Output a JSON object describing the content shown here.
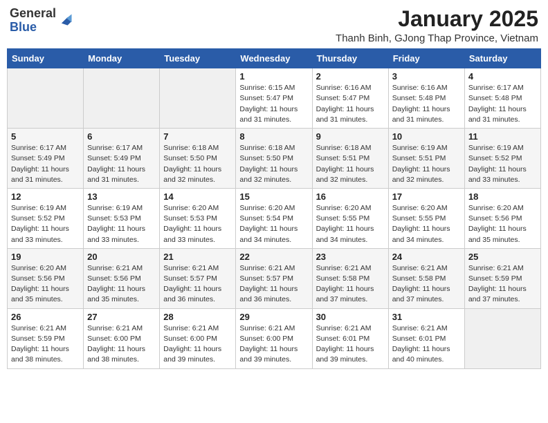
{
  "header": {
    "logo_general": "General",
    "logo_blue": "Blue",
    "month_year": "January 2025",
    "location": "Thanh Binh, GJong Thap Province, Vietnam"
  },
  "days_of_week": [
    "Sunday",
    "Monday",
    "Tuesday",
    "Wednesday",
    "Thursday",
    "Friday",
    "Saturday"
  ],
  "weeks": [
    {
      "days": [
        {
          "num": "",
          "info": ""
        },
        {
          "num": "",
          "info": ""
        },
        {
          "num": "",
          "info": ""
        },
        {
          "num": "1",
          "info": "Sunrise: 6:15 AM\nSunset: 5:47 PM\nDaylight: 11 hours\nand 31 minutes."
        },
        {
          "num": "2",
          "info": "Sunrise: 6:16 AM\nSunset: 5:47 PM\nDaylight: 11 hours\nand 31 minutes."
        },
        {
          "num": "3",
          "info": "Sunrise: 6:16 AM\nSunset: 5:48 PM\nDaylight: 11 hours\nand 31 minutes."
        },
        {
          "num": "4",
          "info": "Sunrise: 6:17 AM\nSunset: 5:48 PM\nDaylight: 11 hours\nand 31 minutes."
        }
      ]
    },
    {
      "days": [
        {
          "num": "5",
          "info": "Sunrise: 6:17 AM\nSunset: 5:49 PM\nDaylight: 11 hours\nand 31 minutes."
        },
        {
          "num": "6",
          "info": "Sunrise: 6:17 AM\nSunset: 5:49 PM\nDaylight: 11 hours\nand 31 minutes."
        },
        {
          "num": "7",
          "info": "Sunrise: 6:18 AM\nSunset: 5:50 PM\nDaylight: 11 hours\nand 32 minutes."
        },
        {
          "num": "8",
          "info": "Sunrise: 6:18 AM\nSunset: 5:50 PM\nDaylight: 11 hours\nand 32 minutes."
        },
        {
          "num": "9",
          "info": "Sunrise: 6:18 AM\nSunset: 5:51 PM\nDaylight: 11 hours\nand 32 minutes."
        },
        {
          "num": "10",
          "info": "Sunrise: 6:19 AM\nSunset: 5:51 PM\nDaylight: 11 hours\nand 32 minutes."
        },
        {
          "num": "11",
          "info": "Sunrise: 6:19 AM\nSunset: 5:52 PM\nDaylight: 11 hours\nand 33 minutes."
        }
      ]
    },
    {
      "days": [
        {
          "num": "12",
          "info": "Sunrise: 6:19 AM\nSunset: 5:52 PM\nDaylight: 11 hours\nand 33 minutes."
        },
        {
          "num": "13",
          "info": "Sunrise: 6:19 AM\nSunset: 5:53 PM\nDaylight: 11 hours\nand 33 minutes."
        },
        {
          "num": "14",
          "info": "Sunrise: 6:20 AM\nSunset: 5:53 PM\nDaylight: 11 hours\nand 33 minutes."
        },
        {
          "num": "15",
          "info": "Sunrise: 6:20 AM\nSunset: 5:54 PM\nDaylight: 11 hours\nand 34 minutes."
        },
        {
          "num": "16",
          "info": "Sunrise: 6:20 AM\nSunset: 5:55 PM\nDaylight: 11 hours\nand 34 minutes."
        },
        {
          "num": "17",
          "info": "Sunrise: 6:20 AM\nSunset: 5:55 PM\nDaylight: 11 hours\nand 34 minutes."
        },
        {
          "num": "18",
          "info": "Sunrise: 6:20 AM\nSunset: 5:56 PM\nDaylight: 11 hours\nand 35 minutes."
        }
      ]
    },
    {
      "days": [
        {
          "num": "19",
          "info": "Sunrise: 6:20 AM\nSunset: 5:56 PM\nDaylight: 11 hours\nand 35 minutes."
        },
        {
          "num": "20",
          "info": "Sunrise: 6:21 AM\nSunset: 5:56 PM\nDaylight: 11 hours\nand 35 minutes."
        },
        {
          "num": "21",
          "info": "Sunrise: 6:21 AM\nSunset: 5:57 PM\nDaylight: 11 hours\nand 36 minutes."
        },
        {
          "num": "22",
          "info": "Sunrise: 6:21 AM\nSunset: 5:57 PM\nDaylight: 11 hours\nand 36 minutes."
        },
        {
          "num": "23",
          "info": "Sunrise: 6:21 AM\nSunset: 5:58 PM\nDaylight: 11 hours\nand 37 minutes."
        },
        {
          "num": "24",
          "info": "Sunrise: 6:21 AM\nSunset: 5:58 PM\nDaylight: 11 hours\nand 37 minutes."
        },
        {
          "num": "25",
          "info": "Sunrise: 6:21 AM\nSunset: 5:59 PM\nDaylight: 11 hours\nand 37 minutes."
        }
      ]
    },
    {
      "days": [
        {
          "num": "26",
          "info": "Sunrise: 6:21 AM\nSunset: 5:59 PM\nDaylight: 11 hours\nand 38 minutes."
        },
        {
          "num": "27",
          "info": "Sunrise: 6:21 AM\nSunset: 6:00 PM\nDaylight: 11 hours\nand 38 minutes."
        },
        {
          "num": "28",
          "info": "Sunrise: 6:21 AM\nSunset: 6:00 PM\nDaylight: 11 hours\nand 39 minutes."
        },
        {
          "num": "29",
          "info": "Sunrise: 6:21 AM\nSunset: 6:00 PM\nDaylight: 11 hours\nand 39 minutes."
        },
        {
          "num": "30",
          "info": "Sunrise: 6:21 AM\nSunset: 6:01 PM\nDaylight: 11 hours\nand 39 minutes."
        },
        {
          "num": "31",
          "info": "Sunrise: 6:21 AM\nSunset: 6:01 PM\nDaylight: 11 hours\nand 40 minutes."
        },
        {
          "num": "",
          "info": ""
        }
      ]
    }
  ]
}
